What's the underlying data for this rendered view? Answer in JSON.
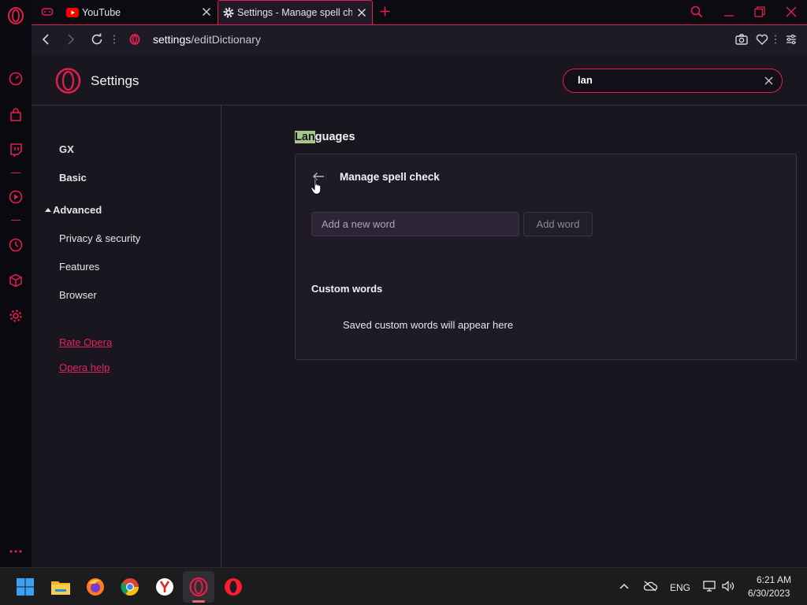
{
  "tabs": [
    {
      "label": "YouTube"
    },
    {
      "label": "Settings - Manage spell check"
    }
  ],
  "address": {
    "url_host": "settings",
    "url_path": "/editDictionary"
  },
  "header": {
    "title": "Settings",
    "search_value": "lan"
  },
  "sidebar": {
    "items": [
      {
        "label": "GX"
      },
      {
        "label": "Basic"
      },
      {
        "label": "Advanced"
      },
      {
        "label": "Privacy & security"
      },
      {
        "label": "Features"
      },
      {
        "label": "Browser"
      }
    ],
    "links": [
      {
        "label": "Rate Opera"
      },
      {
        "label": "Opera help"
      }
    ]
  },
  "main": {
    "section_title_highlight": "Lan",
    "section_title_rest": "guages",
    "card": {
      "title": "Manage spell check",
      "input_placeholder": "Add a new word",
      "add_button": "Add word",
      "custom_title": "Custom words",
      "custom_empty": "Saved custom words will appear here"
    }
  },
  "taskbar": {
    "lang": "ENG",
    "time": "6:21 AM",
    "date": "6/30/2023"
  },
  "colors": {
    "accent": "#e01f4d",
    "highlight": "#a7c78e",
    "background": "#1a1620"
  }
}
